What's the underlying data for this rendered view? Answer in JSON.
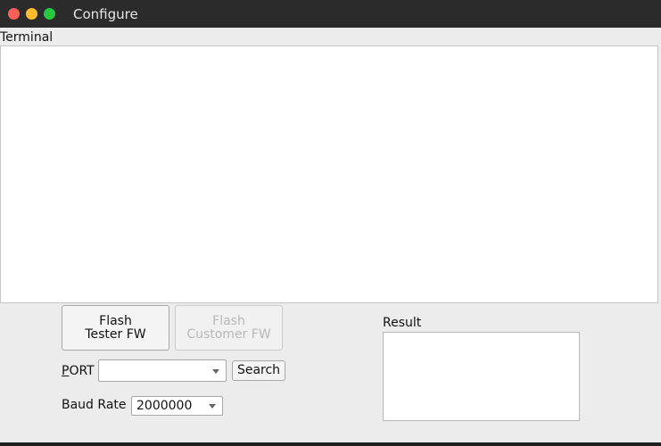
{
  "window": {
    "title": "Configure"
  },
  "terminal": {
    "label": "Terminal",
    "content": ""
  },
  "buttons": {
    "flash_tester_line1": "Flash",
    "flash_tester_line2": "Tester FW",
    "flash_customer_line1": "Flash",
    "flash_customer_line2": "Customer FW",
    "search_label": "Search"
  },
  "port": {
    "label_mnemonic": "P",
    "label_rest": "ORT",
    "selected": ""
  },
  "baud": {
    "label": "Baud Rate",
    "selected": "2000000"
  },
  "result": {
    "label": "Result",
    "content": ""
  }
}
